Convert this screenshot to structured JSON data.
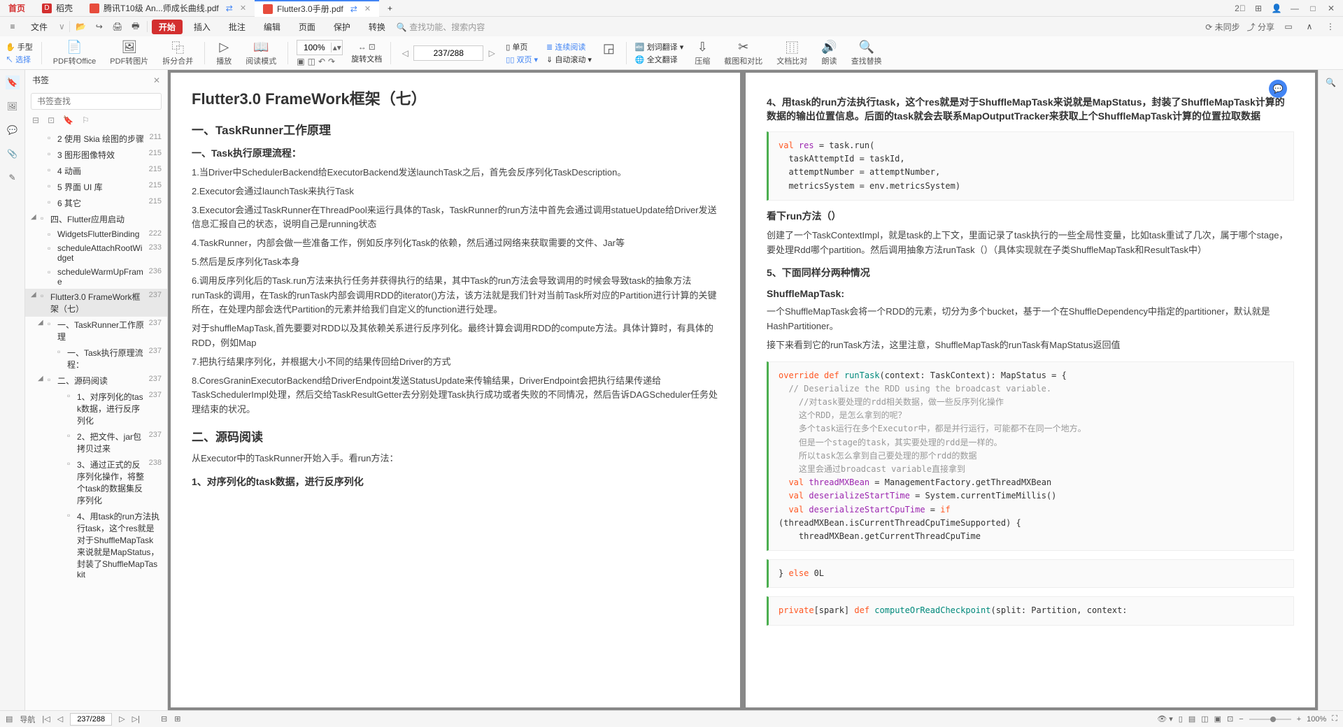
{
  "tabs": {
    "home": "首页",
    "app": "稻壳",
    "tab1": "腾讯T10级 An...师成长曲线.pdf",
    "tab2": "Flutter3.0手册.pdf"
  },
  "menu": {
    "file": "文件",
    "items": [
      "开始",
      "插入",
      "批注",
      "编辑",
      "页面",
      "保护",
      "转换"
    ],
    "search_placeholder": "查找功能、搜索内容",
    "unsync": "未同步",
    "share": "分享"
  },
  "toolbar": {
    "hand": "手型",
    "select": "选择",
    "pdf2office": "PDF转Office",
    "pdf2img": "PDF转图片",
    "split": "拆分合并",
    "play": "播放",
    "readmode": "阅读模式",
    "zoom": "100%",
    "rotatepage": "旋转文档",
    "single": "单页",
    "double": "双页",
    "continuous": "连续阅读",
    "autoscroll": "自动滚动",
    "pager": "237/288",
    "wordtrans": "划词翻译",
    "fulltrans": "全文翻译",
    "compress": "压缩",
    "screenshot": "截图和对比",
    "textcompare": "文档比对",
    "read": "朗读",
    "findreplace": "查找替换"
  },
  "vtoolbar": {
    "bookmark": "书签"
  },
  "sidebar": {
    "title": "书签",
    "search_placeholder": "书签查找",
    "items": [
      {
        "label": "2 使用 Skia 绘图的步骤",
        "page": "211",
        "indent": 1
      },
      {
        "label": "3 图形图像特效",
        "page": "215",
        "indent": 1
      },
      {
        "label": "4 动画",
        "page": "215",
        "indent": 1
      },
      {
        "label": "5 界面 UI 库",
        "page": "215",
        "indent": 1
      },
      {
        "label": "6 其它",
        "page": "215",
        "indent": 1
      },
      {
        "label": "四、Flutter应用启动",
        "page": "",
        "indent": 0,
        "arrow": true
      },
      {
        "label": "WidgetsFlutterBinding",
        "page": "222",
        "indent": 1
      },
      {
        "label": "scheduleAttachRootWidget",
        "page": "233",
        "indent": 1
      },
      {
        "label": "scheduleWarmUpFrame",
        "page": "236",
        "indent": 1
      },
      {
        "label": "Flutter3.0 FrameWork框架（七）",
        "page": "237",
        "indent": 0,
        "arrow": true,
        "sel": true
      },
      {
        "label": "一、TaskRunner工作原理",
        "page": "237",
        "indent": 1,
        "arrow": true
      },
      {
        "label": "一、Task执行原理流程：",
        "page": "237",
        "indent": 2
      },
      {
        "label": "二、源码阅读",
        "page": "237",
        "indent": 1,
        "arrow": true
      },
      {
        "label": "1、对序列化的task数据，进行反序列化",
        "page": "237",
        "indent": 3
      },
      {
        "label": "2、把文件、jar包拷贝过来",
        "page": "237",
        "indent": 3
      },
      {
        "label": "3、通过正式的反序列化操作，将整个task的数据集反序列化",
        "page": "238",
        "indent": 3
      },
      {
        "label": "4、用task的run方法执行task，这个res就是对于ShuffleMapTask来说就是MapStatus，封装了ShuffleMapTaskit",
        "page": "",
        "indent": 3
      }
    ]
  },
  "doc": {
    "left": {
      "h1": "Flutter3.0 FrameWork框架（七）",
      "h2_1": "一、TaskRunner工作原理",
      "h3_1": "一、Task执行原理流程：",
      "p1": "1.当Driver中SchedulerBackend给ExecutorBackend发送launchTask之后，首先会反序列化TaskDescription。",
      "p2": "2.Executor会通过launchTask来执行Task",
      "p3": "3.Executor会通过TaskRunner在ThreadPool来运行具体的Task，TaskRunner的run方法中首先会通过调用statueUpdate给Driver发送信息汇报自己的状态，说明自己是running状态",
      "p4": "4.TaskRunner，内部会做一些准备工作，例如反序列化Task的依赖，然后通过网络来获取需要的文件、Jar等",
      "p5": "5.然后是反序列化Task本身",
      "p6": "6.调用反序列化后的Task.run方法来执行任务并获得执行的结果，其中Task的run方法会导致调用的时候会导致task的抽象方法runTask的调用，在Task的runTask内部会调用RDD的iterator()方法，该方法就是我们针对当前Task所对应的Partition进行计算的关键所在，在处理内部会迭代Partition的元素并给我们自定义的function进行处理。",
      "p7": "对于shuffleMapTask,首先要要对RDD以及其依赖关系进行反序列化。最终计算会调用RDD的compute方法。具体计算时，有具体的RDD，例如Map",
      "p8": "7.把执行结果序列化，并根据大小不同的结果传回给Driver的方式",
      "p9": "8.CoresGraninExecutorBackend给DriverEndpoint发送StatusUpdate来传输结果，DriverEndpoint会把执行结果传递给TaskSchedulerImpl处理，然后交给TaskResultGetter去分别处理Task执行成功或者失败的不同情况，然后告诉DAGScheduler任务处理结束的状况。",
      "h2_2": "二、源码阅读",
      "p10": "从Executor中的TaskRunner开始入手。看run方法：",
      "h3_2": "1、对序列化的task数据，进行反序列化"
    },
    "right": {
      "h3_1": "4、用task的run方法执行task，这个res就是对于ShuffleMapTask来说就是MapStatus，封装了ShuffleMapTask计算的数据的输出位置信息。后面的task就会去联系MapOutputTracker来获取上个ShuffleMapTask计算的位置拉取数据",
      "code1": "val res = task.run(\n  taskAttemptId = taskId,\n  attemptNumber = attemptNumber,\n  metricsSystem = env.metricsSystem)",
      "h3_2": "看下run方法（）",
      "p1": "创建了一个TaskContextImpl，就是task的上下文，里面记录了task执行的一些全局性变量，比如task重试了几次，属于哪个stage，要处理Rdd哪个partition。然后调用抽象方法runTask（）（具体实现就在子类ShuffleMapTask和ResultTask中）",
      "h3_3": "5、下面同样分两种情况",
      "h3_4": "ShuffleMapTask:",
      "p2": "一个ShuffleMapTask会将一个RDD的元素，切分为多个bucket，基于一个在ShuffleDependency中指定的partitioner，默认就是HashPartitioner。",
      "p3": "接下来看到它的runTask方法，这里注意，ShuffleMapTask的runTask有MapStatus返回值",
      "code2_l1": "override def runTask(context: TaskContext): MapStatus = {",
      "code2_l2": "  // Deserialize the RDD using the broadcast variable.",
      "code2_l3": "  //对task要处理的rdd相关数据，做一些反序列化操作",
      "code2_l4": "    这个RDD，是怎么拿到的呢？",
      "code2_l5": "    多个task运行在多个Executor中，都是并行运行，可能都不在同一个地方。",
      "code2_l6": "    但是一个stage的task，其实要处理的rdd是一样的。",
      "code2_l7": "    所以task怎么拿到自己要处理的那个rdd的数据",
      "code2_l8": "    这里会通过broadcast variable直接拿到",
      "code2_l9": "  val threadMXBean = ManagementFactory.getThreadMXBean",
      "code2_l10": "  val deserializeStartTime = System.currentTimeMillis()",
      "code2_l11": "  val deserializeStartCpuTime = if",
      "code2_l12": "(threadMXBean.isCurrentThreadCpuTimeSupported) {",
      "code2_l13": "    threadMXBean.getCurrentThreadCpuTime",
      "code3": "} else 0L",
      "code4": "private[spark] def computeOrReadCheckpoint(split: Partition, context:"
    }
  },
  "status": {
    "nav": "导航",
    "pager": "237/288",
    "zoom": "100%"
  }
}
